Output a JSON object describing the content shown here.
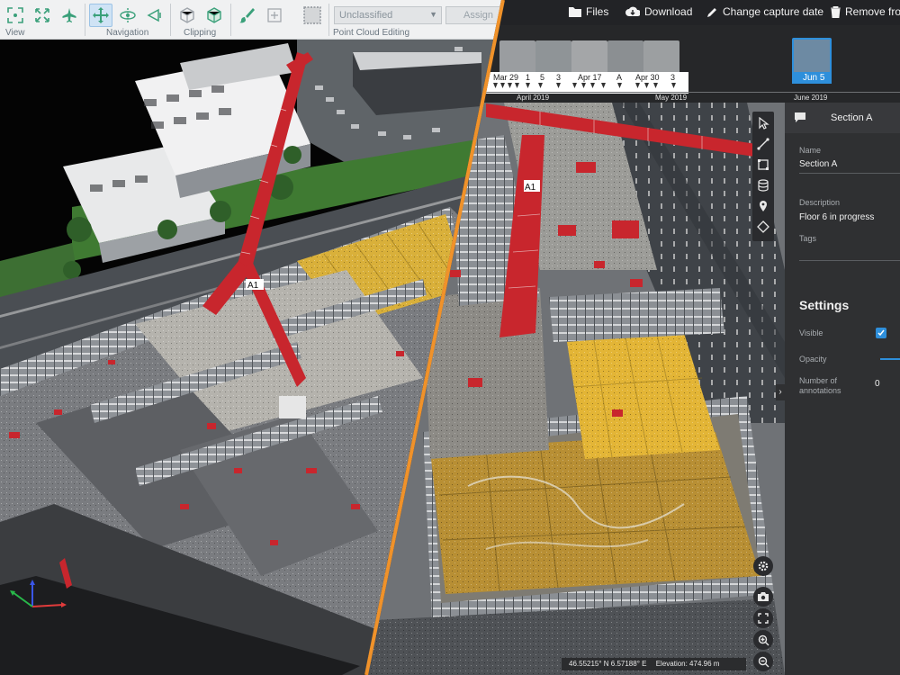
{
  "left_toolbar": {
    "groups": [
      {
        "label": "View"
      },
      {
        "label": "Navigation"
      },
      {
        "label": "Clipping"
      },
      {
        "label": "Point Cloud Editing"
      }
    ],
    "classification_select": {
      "value": "Unclassified"
    },
    "assign_label": "Assign",
    "icons": [
      "fit-view-icon",
      "expand-icon",
      "plane-icon",
      "pan-move-icon",
      "orbit-icon",
      "walk-icon",
      "box-clip-icon",
      "cube-clip-icon",
      "brush-icon",
      "polygon-select-icon",
      "rectangle-select-icon"
    ]
  },
  "top_bar": {
    "files_label": "Files",
    "download_label": "Download",
    "change_capture_label": "Change capture date",
    "remove_label": "Remove from"
  },
  "timeline": {
    "strip_dates": [
      "Mar 29",
      "1",
      "5",
      "3",
      "Apr 17",
      "A",
      "Apr 30",
      "3"
    ],
    "months": [
      "April 2019",
      "May 2019",
      "June 2019"
    ],
    "selected": {
      "label": "Jun 5"
    }
  },
  "panel": {
    "title": "Section A",
    "name_label": "Name",
    "name_value": "Section A",
    "description_label": "Description",
    "description_value": "Floor 6 in progress",
    "tags_label": "Tags",
    "settings_title": "Settings",
    "visible_label": "Visible",
    "visible_checked": true,
    "opacity_label": "Opacity",
    "annotations_label_1": "Number of",
    "annotations_label_2": "annotations",
    "annotations_value": "0"
  },
  "status": {
    "coordinates": "46.55215° N 6.57188° E",
    "elevation": "Elevation: 474.96 m"
  },
  "colors": {
    "divider": "#f0922a",
    "accent": "#2e8fdb",
    "crane": "#c8262d",
    "formwork": "#d9b03a"
  }
}
